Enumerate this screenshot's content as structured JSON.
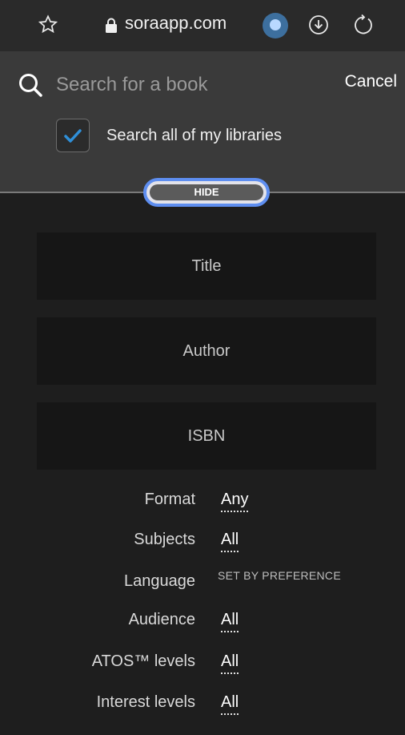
{
  "browser": {
    "url": "soraapp.com",
    "icons": [
      "star-icon",
      "lock-icon",
      "extension-icon",
      "download-icon",
      "reload-icon"
    ]
  },
  "search": {
    "placeholder": "Search for a book",
    "value": "",
    "cancel_label": "Cancel",
    "all_libraries_label": "Search all of my libraries",
    "all_libraries_checked": true,
    "hide_label": "HIDE"
  },
  "fields": {
    "title": "Title",
    "author": "Author",
    "isbn": "ISBN"
  },
  "filters": [
    {
      "label": "Format",
      "value": "Any"
    },
    {
      "label": "Subjects",
      "value": "All"
    },
    {
      "label": "Language",
      "value": "SET BY PREFERENCE"
    },
    {
      "label": "Audience",
      "value": "All"
    },
    {
      "label": "ATOS™ levels",
      "value": "All"
    },
    {
      "label": "Interest levels",
      "value": "All"
    }
  ],
  "colors": {
    "accent": "#5e8ef0",
    "checkmark": "#2f8fd8",
    "panel_bg": "#3a3a3a",
    "page_bg": "#1e1e1e"
  }
}
